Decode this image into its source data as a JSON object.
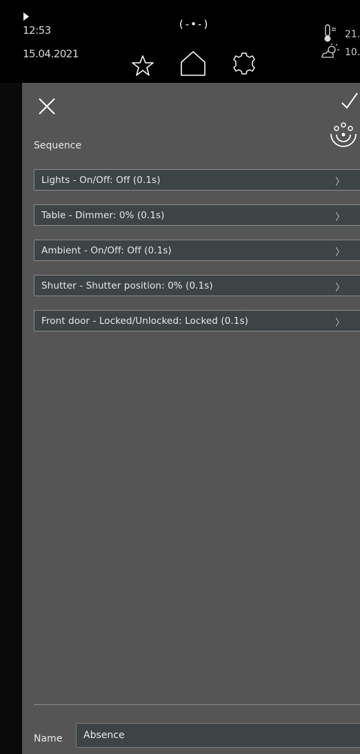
{
  "status": {
    "time": "12:53",
    "date": "15.04.2021",
    "connection": "(-•-)",
    "temperature": "21.",
    "weather": "10."
  },
  "nav_icons": [
    "star-icon",
    "home-icon",
    "gear-icon"
  ],
  "panel": {
    "section_title": "Sequence",
    "items": [
      {
        "label": "Lights - On/Off: Off (0.1s)"
      },
      {
        "label": "Table - Dimmer: 0% (0.1s)"
      },
      {
        "label": "Ambient - On/Off: Off (0.1s)"
      },
      {
        "label": "Shutter - Shutter position: 0% (0.1s)"
      },
      {
        "label": "Front door - Locked/Unlocked: Locked (0.1s)"
      }
    ],
    "chevron": "〉",
    "name_label": "Name",
    "name_value": "Absence"
  },
  "colors": {
    "panel_bg": "#555555",
    "item_bg": "#3d4446",
    "statusbar_bg": "#000000"
  }
}
